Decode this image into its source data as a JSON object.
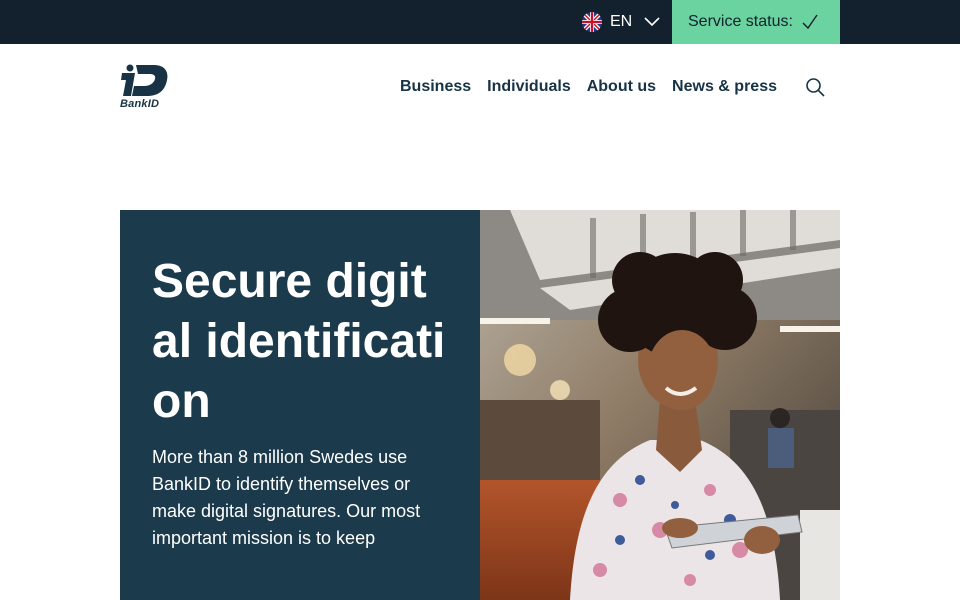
{
  "topbar": {
    "language": "EN",
    "language_icon": "uk-flag-icon",
    "service_status_label": "Service status:",
    "service_status_icon": "check-icon",
    "service_status_color": "#6ad3a0"
  },
  "header": {
    "logo_text": "BankID",
    "nav": [
      "Business",
      "Individuals",
      "About us",
      "News & press"
    ],
    "search_icon": "search-icon"
  },
  "hero": {
    "title": "Secure digital identification",
    "text": "More than 8 million Swedes use BankID to identify themselves or make digital signatures. Our most important mission is to keep",
    "panel_color": "#1b3a4b",
    "image": "woman-with-tablet-photo"
  }
}
